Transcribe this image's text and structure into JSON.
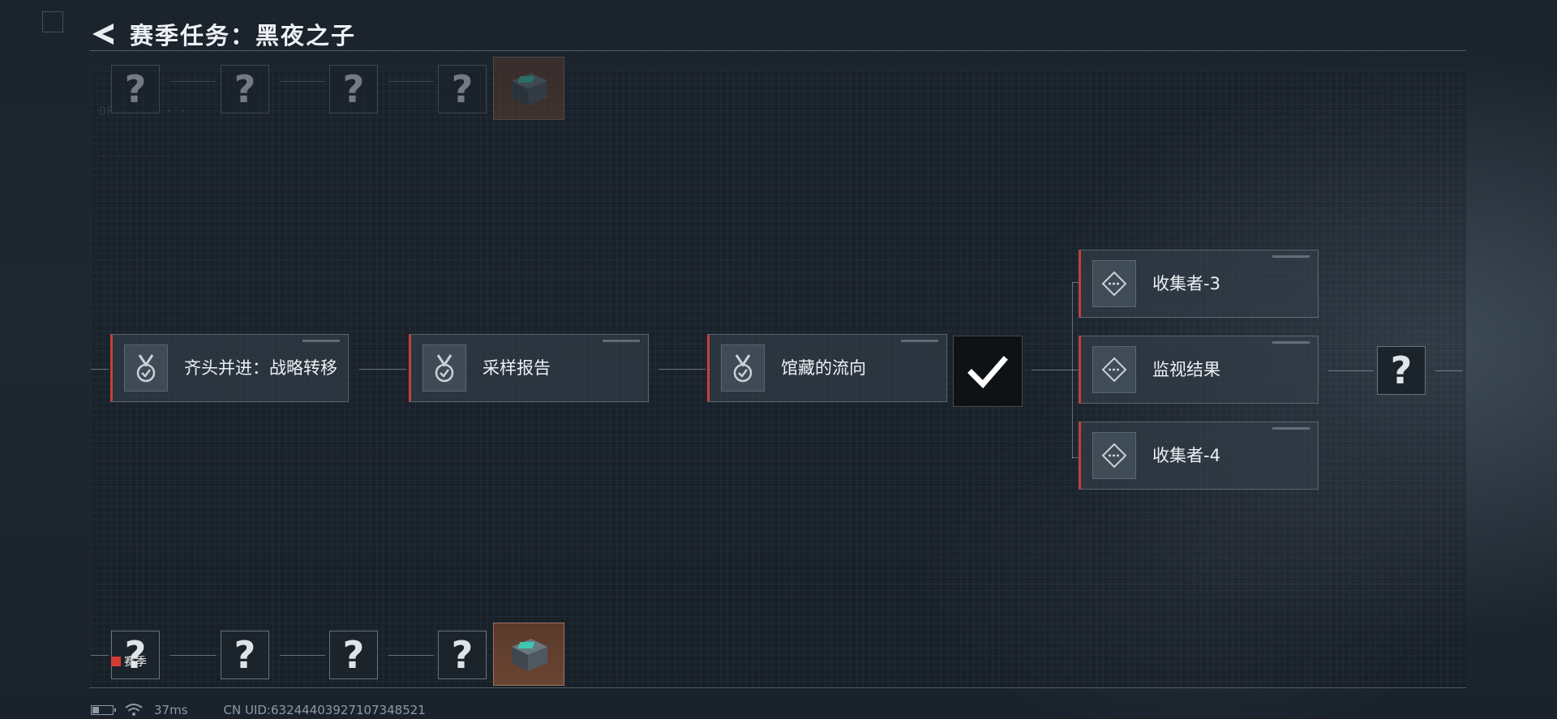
{
  "header": {
    "title": "赛季任务：黑夜之子",
    "back_icon": "back-arrow-icon"
  },
  "quests": [
    {
      "label": "齐头并进：战略转移",
      "icon": "medal-check-icon",
      "accent": "#c2423b"
    },
    {
      "label": "采样报告",
      "icon": "medal-check-icon",
      "accent": "#c2423b"
    },
    {
      "label": "馆藏的流向",
      "icon": "medal-check-icon",
      "accent": "#c2423b"
    }
  ],
  "completed_marker": {
    "icon": "checkmark-icon"
  },
  "branch_quests": [
    {
      "label": "收集者-3",
      "icon": "diamond-target-icon"
    },
    {
      "label": "监视结果",
      "icon": "diamond-target-icon"
    },
    {
      "label": "收集者-4",
      "icon": "diamond-target-icon"
    }
  ],
  "unknown_next": {
    "symbol": "?"
  },
  "top_track": {
    "symbols": [
      "?",
      "?",
      "?",
      "?"
    ],
    "reward_icon": "supply-crate-icon"
  },
  "bottom_track": {
    "symbols": [
      "?",
      "?",
      "?",
      "?"
    ],
    "reward_icon": "supply-crate-icon"
  },
  "season_tag": {
    "label": "赛季",
    "color": "#d43c33"
  },
  "status_bar": {
    "ping": "37ms",
    "uid": "CN UID:632444039271073485​21"
  }
}
